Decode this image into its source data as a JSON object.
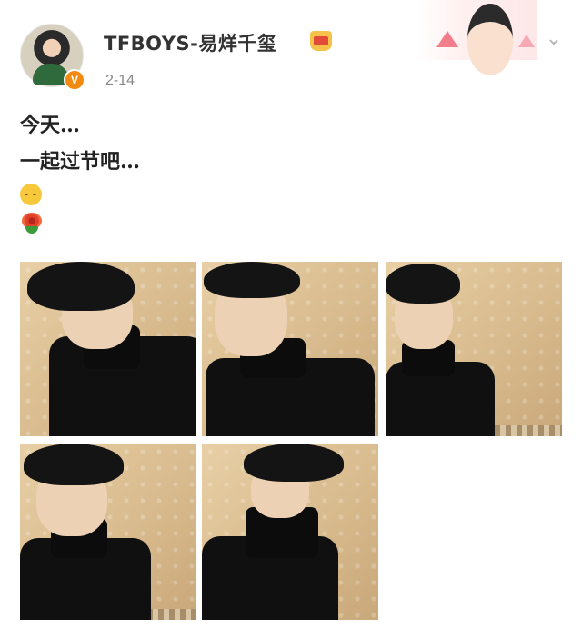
{
  "post": {
    "author": "TFBOYS-易烊千玺",
    "verified_badge": "V",
    "date": "2-14",
    "text_lines": [
      "今天…",
      "一起过节吧…"
    ],
    "emoji": [
      "hugging-face-icon",
      "rose-icon"
    ],
    "photos": [
      {
        "name": "photo-1"
      },
      {
        "name": "photo-2"
      },
      {
        "name": "photo-3"
      },
      {
        "name": "photo-4"
      },
      {
        "name": "photo-5"
      }
    ]
  },
  "colors": {
    "accent_badge": "#f28a11",
    "crown": "#f6c24a",
    "date_text": "#888888",
    "chevron": "#b5b5b5"
  }
}
